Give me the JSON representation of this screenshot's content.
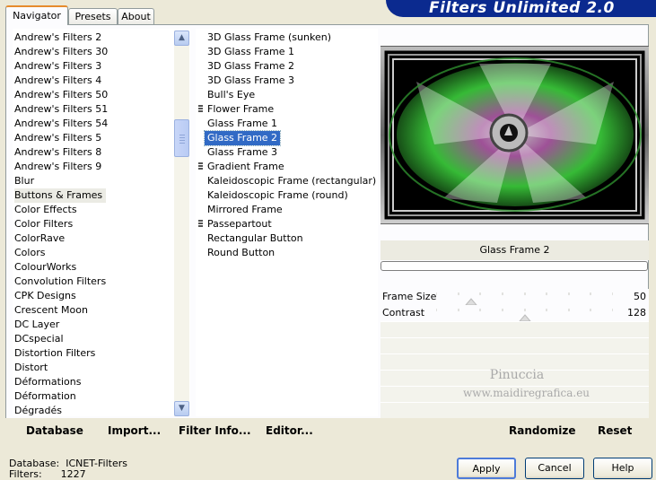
{
  "tabs": [
    {
      "label": "Navigator",
      "active": true
    },
    {
      "label": "Presets",
      "active": false
    },
    {
      "label": "About",
      "active": false
    }
  ],
  "app_title": "Filters Unlimited 2.0",
  "categories": [
    "Andrew's Filters 2",
    "Andrew's Filters 30",
    "Andrew's Filters 3",
    "Andrew's Filters 4",
    "Andrew's Filters 50",
    "Andrew's Filters 51",
    "Andrew's Filters 54",
    "Andrew's Filters 5",
    "Andrew's Filters 8",
    "Andrew's Filters 9",
    "Blur",
    "Buttons & Frames",
    "Color Effects",
    "Color Filters",
    "ColorRave",
    "Colors",
    "ColourWorks",
    "Convolution Filters",
    "CPK Designs",
    "Crescent Moon",
    "DC Layer",
    "DCspecial",
    "Distortion Filters",
    "Distort",
    "Déformations",
    "Déformation",
    "Dégradés"
  ],
  "selected_category": "Buttons & Frames",
  "filters": [
    {
      "label": "3D Glass Frame (sunken)",
      "group": false
    },
    {
      "label": "3D Glass Frame 1",
      "group": false
    },
    {
      "label": "3D Glass Frame 2",
      "group": false
    },
    {
      "label": "3D Glass Frame 3",
      "group": false
    },
    {
      "label": "Bull's Eye",
      "group": false
    },
    {
      "label": "Flower Frame",
      "group": true
    },
    {
      "label": "Glass Frame 1",
      "group": false
    },
    {
      "label": "Glass Frame 2",
      "group": false
    },
    {
      "label": "Glass Frame 3",
      "group": false
    },
    {
      "label": "Gradient Frame",
      "group": true
    },
    {
      "label": "Kaleidoscopic Frame (rectangular)",
      "group": false
    },
    {
      "label": "Kaleidoscopic Frame (round)",
      "group": false
    },
    {
      "label": "Mirrored Frame",
      "group": false
    },
    {
      "label": "Passepartout",
      "group": true
    },
    {
      "label": "Rectangular Button",
      "group": false
    },
    {
      "label": "Round Button",
      "group": false
    }
  ],
  "selected_filter": "Glass Frame 2",
  "filter_name": "Glass Frame 2",
  "params": [
    {
      "label": "Frame Size",
      "value": "50",
      "fraction": 0.196
    },
    {
      "label": "Contrast",
      "value": "128",
      "fraction": 0.502
    }
  ],
  "watermark": {
    "line1": "Pinuccia",
    "line2": "www.maidiregrafica.eu"
  },
  "toolbar": {
    "database": "Database",
    "import": "Import...",
    "filter_info": "Filter Info...",
    "editor": "Editor...",
    "randomize": "Randomize",
    "reset": "Reset"
  },
  "status": {
    "database_label": "Database:",
    "database_value": "ICNET-Filters",
    "filters_label": "Filters:",
    "filters_value": "1227"
  },
  "buttons": {
    "apply": "Apply",
    "cancel": "Cancel",
    "help": "Help"
  },
  "colors": {
    "banner": "#0b2a8f",
    "selection": "#316ac5",
    "preview_green": "#3ccf3c",
    "preview_pink": "#b05aa8"
  }
}
